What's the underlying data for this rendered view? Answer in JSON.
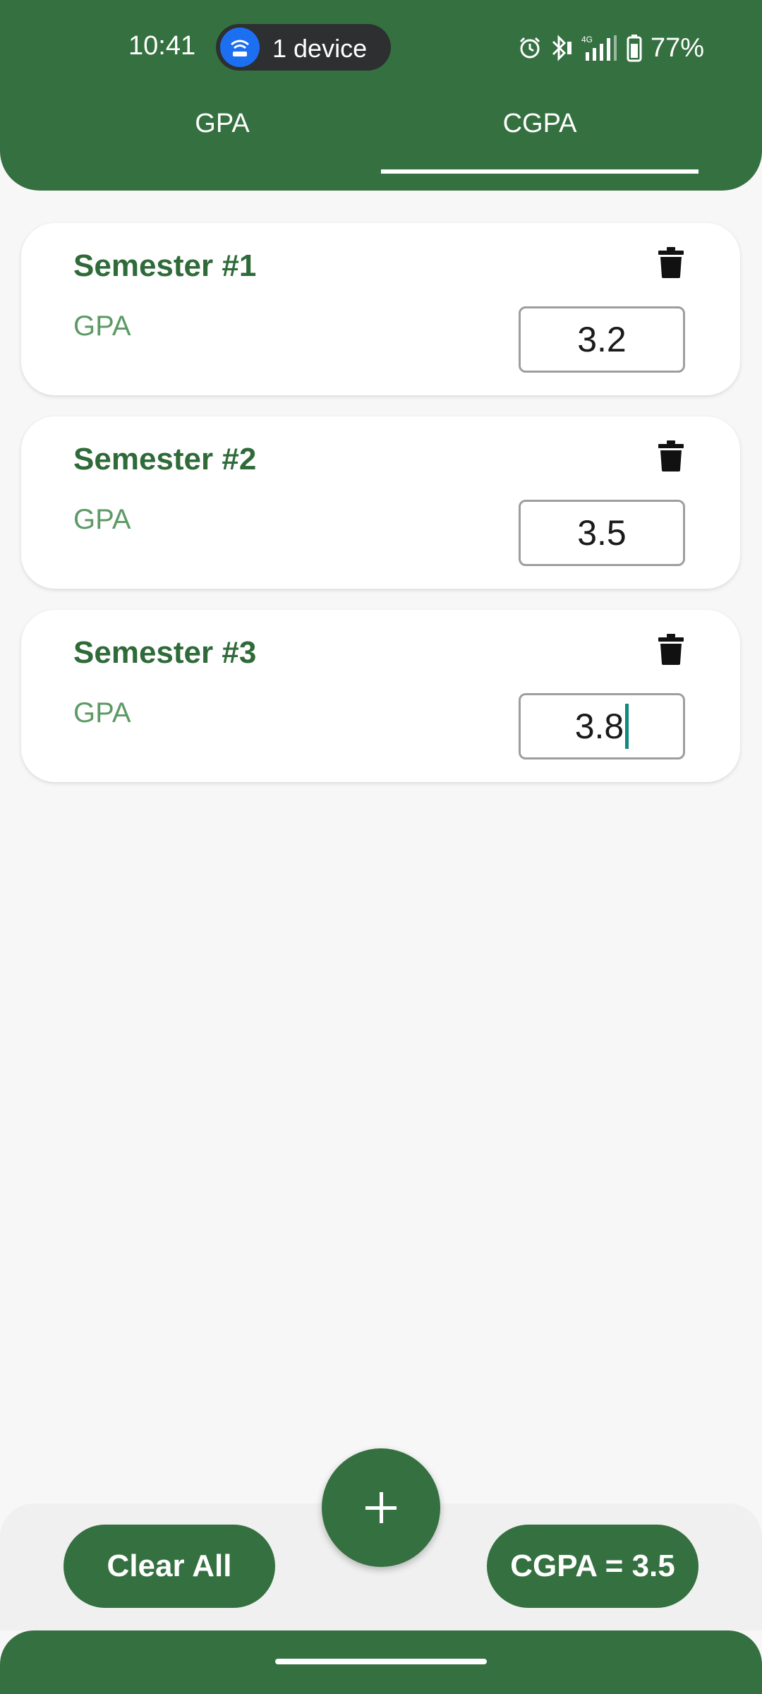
{
  "status_bar": {
    "time": "10:41",
    "hotspot_label": "1 device",
    "battery": "77%",
    "icons": [
      "hotspot-icon",
      "alarm-icon",
      "bluetooth-icon",
      "signal-4g-icon",
      "battery-icon"
    ]
  },
  "tabs": [
    {
      "label": "GPA",
      "selected": false
    },
    {
      "label": "CGPA",
      "selected": true
    }
  ],
  "semesters": [
    {
      "title": "Semester #1",
      "gpa_label": "GPA",
      "gpa_value": "3.2"
    },
    {
      "title": "Semester #2",
      "gpa_label": "GPA",
      "gpa_value": "3.5"
    },
    {
      "title": "Semester #3",
      "gpa_label": "GPA",
      "gpa_value": "3.8"
    }
  ],
  "actions": {
    "clear_all": "Clear All",
    "cgpa_result": "CGPA = 3.5",
    "add_icon": "plus-icon"
  },
  "colors": {
    "primary": "#357040",
    "title": "#2f6a39",
    "label": "#5c9a65",
    "cursor": "#108a7c",
    "hotspot": "#1d6ff2"
  }
}
